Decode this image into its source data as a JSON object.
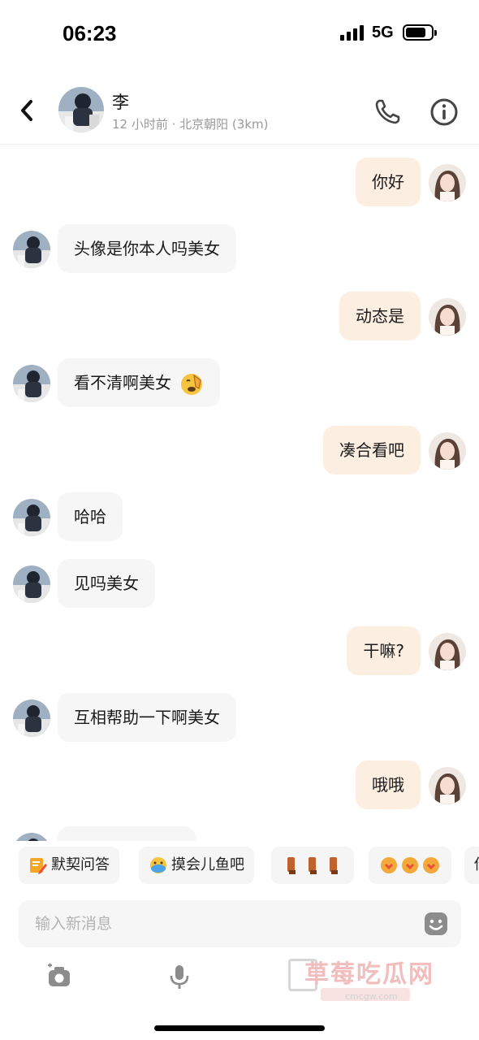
{
  "status_bar": {
    "time": "06:23",
    "network": "5G"
  },
  "header": {
    "back_icon": "chevron-left-icon",
    "name": "李",
    "subtitle": "12 小时前 · 北京朝阳 (3km)",
    "phone_icon": "phone-icon",
    "info_icon": "info-icon"
  },
  "messages": [
    {
      "side": "out",
      "text": "你好"
    },
    {
      "side": "in",
      "text": "头像是你本人吗美女"
    },
    {
      "side": "out",
      "text": "动态是"
    },
    {
      "side": "in",
      "text": "看不清啊美女"
    },
    {
      "side": "out",
      "text": "凑合看吧"
    },
    {
      "side": "in",
      "text": "哈哈"
    },
    {
      "side": "in",
      "text": "见吗美女"
    },
    {
      "side": "out",
      "text": "干嘛?"
    },
    {
      "side": "in",
      "text": "互相帮助一下啊美女"
    },
    {
      "side": "out",
      "text": "哦哦"
    }
  ],
  "quick_replies": [
    {
      "label": "默契问答",
      "icon": "pencil-note-icon"
    },
    {
      "label": "摸会儿鱼吧",
      "icon": "fish-emoji-icon"
    },
    {
      "label": "",
      "icon": "boots-sticker-icon"
    },
    {
      "label": "",
      "icon": "heart-hands-sticker-icon"
    },
    {
      "label": "你",
      "icon": ""
    }
  ],
  "input": {
    "placeholder": "输入新消息"
  },
  "toolbar": {
    "items": [
      "camera-icon",
      "microphone-icon"
    ]
  },
  "watermark": {
    "text": "草莓吃瓜网",
    "sub": "cmcgw.com"
  }
}
